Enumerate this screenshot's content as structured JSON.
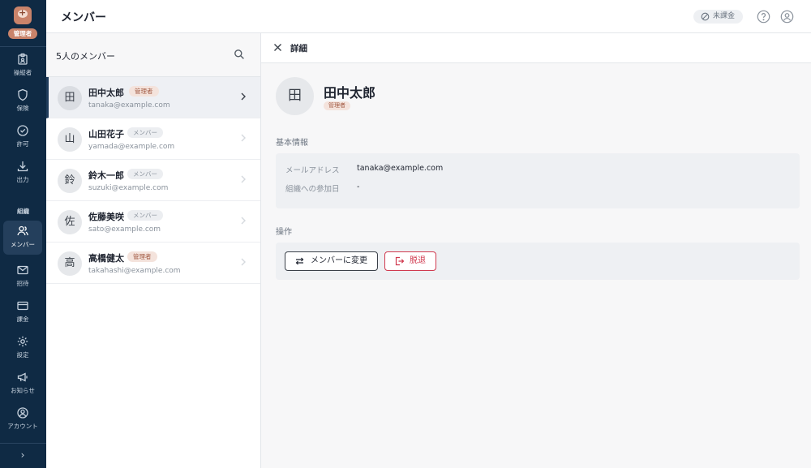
{
  "sidebar": {
    "badge": "管理者",
    "section_org": "組織",
    "items": [
      {
        "label": "操縦者",
        "icon": "clipboard-icon"
      },
      {
        "label": "保険",
        "icon": "shield-icon"
      },
      {
        "label": "許可",
        "icon": "check-badge-icon"
      },
      {
        "label": "出力",
        "icon": "download-icon"
      },
      {
        "label": "メンバー",
        "icon": "users-icon"
      },
      {
        "label": "招待",
        "icon": "mail-icon"
      },
      {
        "label": "課金",
        "icon": "credit-card-icon"
      },
      {
        "label": "設定",
        "icon": "gear-icon"
      },
      {
        "label": "お知らせ",
        "icon": "megaphone-icon"
      },
      {
        "label": "アカウント",
        "icon": "user-circle-icon"
      }
    ],
    "collapse_glyph": "›"
  },
  "header": {
    "title": "メンバー",
    "billing_status": "未課金"
  },
  "list": {
    "count_label": "5人のメンバー",
    "members": [
      {
        "initial": "田",
        "name": "田中太郎",
        "role": "管理者",
        "email": "tanaka@example.com"
      },
      {
        "initial": "山",
        "name": "山田花子",
        "role": "メンバー",
        "email": "yamada@example.com"
      },
      {
        "initial": "鈴",
        "name": "鈴木一郎",
        "role": "メンバー",
        "email": "suzuki@example.com"
      },
      {
        "initial": "佐",
        "name": "佐藤美咲",
        "role": "メンバー",
        "email": "sato@example.com"
      },
      {
        "initial": "高",
        "name": "高橋健太",
        "role": "管理者",
        "email": "takahashi@example.com"
      }
    ]
  },
  "detail": {
    "title": "詳細",
    "initial": "田",
    "name": "田中太郎",
    "role": "管理者",
    "basic_info_label": "基本情報",
    "email_key": "メールアドレス",
    "email_value": "tanaka@example.com",
    "joined_key": "組織への参加日",
    "joined_value": "-",
    "actions_label": "操作",
    "change_button": "メンバーに変更",
    "leave_button": "脱退"
  },
  "colors": {
    "sidebar_bg": "#0f2a44",
    "accent_admin": "#c9836a",
    "danger": "#d03a4f"
  }
}
